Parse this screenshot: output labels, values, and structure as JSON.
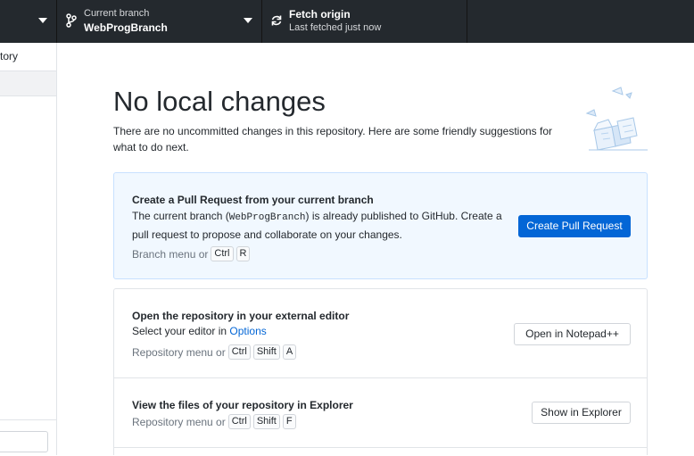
{
  "toolbar": {
    "repo": {
      "icon": "chevron-down-icon"
    },
    "branch": {
      "sub_label": "Current branch",
      "value": "WebProgBranch",
      "icon": "git-branch-icon"
    },
    "fetch": {
      "title": "Fetch origin",
      "sub_label": "Last fetched just now",
      "icon": "sync-icon"
    }
  },
  "sidebar": {
    "history_tab": "tory"
  },
  "main": {
    "title": "No local changes",
    "subtitle": "There are no uncommitted changes in this repository. Here are some friendly suggestions for what to do next."
  },
  "suggestions": {
    "pull_request": {
      "title": "Create a Pull Request from your current branch",
      "text_before": "The current branch (",
      "branch": "WebProgBranch",
      "text_after": ") is already published to GitHub. Create a pull request to propose and collaborate on your changes.",
      "shortcut_prefix": "Branch menu or",
      "keys": [
        "Ctrl",
        "R"
      ],
      "button": "Create Pull Request"
    },
    "editor": {
      "title": "Open the repository in your external editor",
      "text": "Select your editor in",
      "link": "Options",
      "shortcut_prefix": "Repository menu or",
      "keys": [
        "Ctrl",
        "Shift",
        "A"
      ],
      "button": "Open in Notepad++"
    },
    "explorer": {
      "title": "View the files of your repository in Explorer",
      "shortcut_prefix": "Repository menu or",
      "keys": [
        "Ctrl",
        "Shift",
        "F"
      ],
      "button": "Show in Explorer"
    }
  },
  "colors": {
    "toolbar_bg": "#24292e",
    "accent": "#0366d6",
    "pr_card_bg": "#f1f8ff"
  }
}
